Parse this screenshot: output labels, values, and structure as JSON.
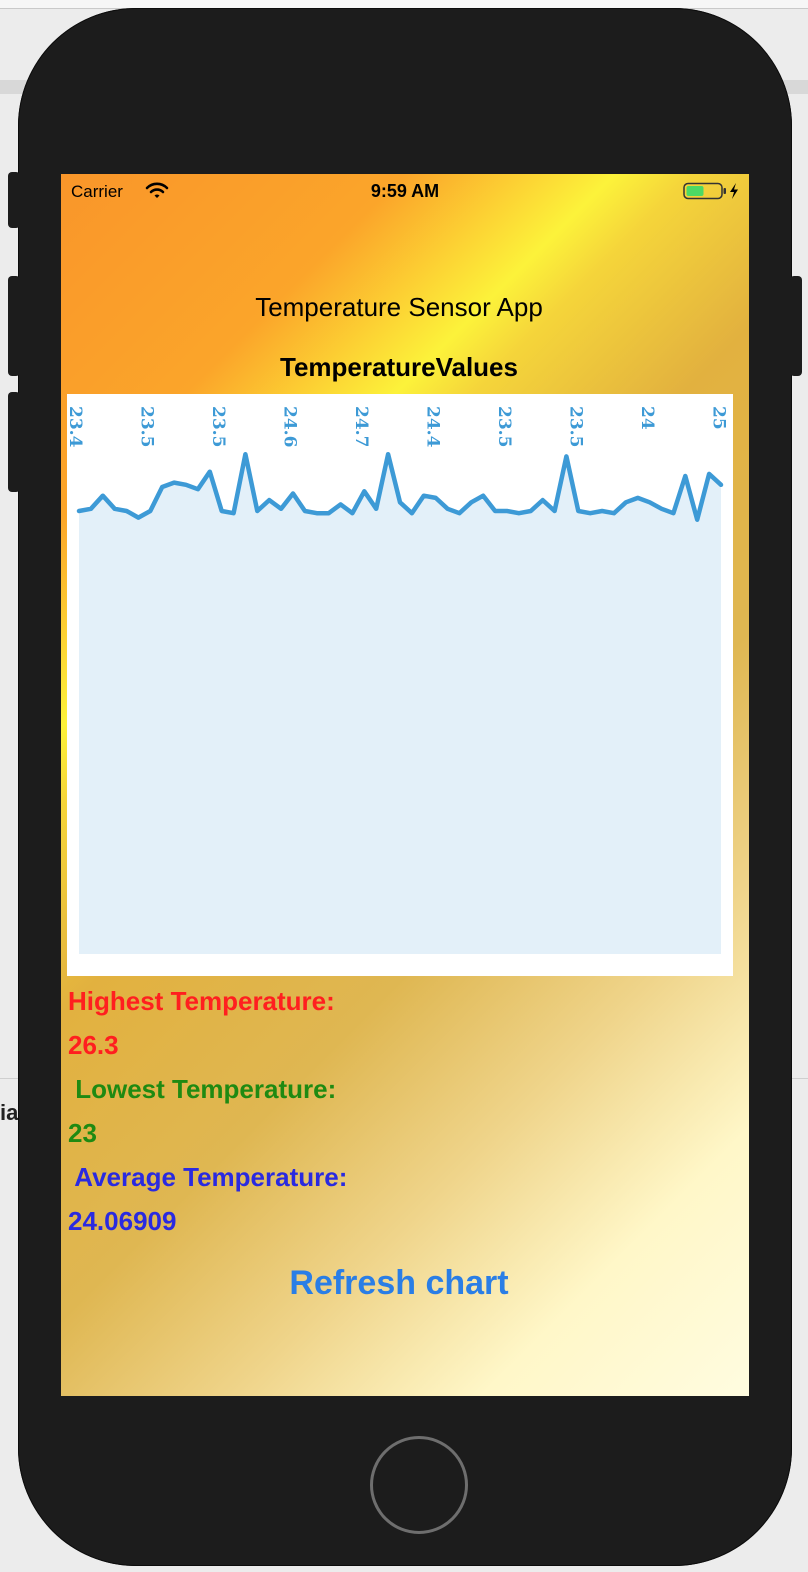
{
  "status_bar": {
    "carrier": "Carrier",
    "time": "9:59 AM"
  },
  "app": {
    "title": "Temperature Sensor App",
    "chart_title": "TemperatureValues",
    "highest_label": "Highest Temperature:",
    "highest_value": "26.3",
    "lowest_label": " Lowest Temperature:",
    "lowest_value": "23",
    "average_label": " Average Temperature:",
    "average_value": "24.06909",
    "refresh_label": "Refresh chart"
  },
  "host": {
    "fragment": "ia"
  },
  "colors": {
    "series_line": "#3d9ad6",
    "series_fill": "#e3f0f9",
    "highest": "#ff1f1f",
    "lowest": "#1f8a12",
    "average": "#2a2ae0",
    "refresh": "#2a7ee6"
  },
  "chart_data": {
    "type": "area",
    "title": "TemperatureValues",
    "top_labels": [
      "23.4",
      "23.5",
      "23.5",
      "24.6",
      "24.7",
      "24.4",
      "23.5",
      "23.5",
      "24",
      "25"
    ],
    "ylim": [
      0,
      26.3
    ],
    "series": [
      {
        "values": [
          23.4,
          23.5,
          24.1,
          23.5,
          23.4,
          23.1,
          23.4,
          24.5,
          24.7,
          24.6,
          24.4,
          25.2,
          23.4,
          23.3,
          26.0,
          23.4,
          23.9,
          23.5,
          24.2,
          23.4,
          23.3,
          23.3,
          23.7,
          23.3,
          24.3,
          23.5,
          26.0,
          23.8,
          23.3,
          24.1,
          24.0,
          23.5,
          23.3,
          23.8,
          24.1,
          23.4,
          23.4,
          23.3,
          23.4,
          23.9,
          23.4,
          25.9,
          23.4,
          23.3,
          23.4,
          23.3,
          23.8,
          24.0,
          23.8,
          23.5,
          23.3,
          25.0,
          23.0,
          25.1,
          24.6
        ]
      }
    ],
    "grid": false,
    "legend": "none"
  }
}
